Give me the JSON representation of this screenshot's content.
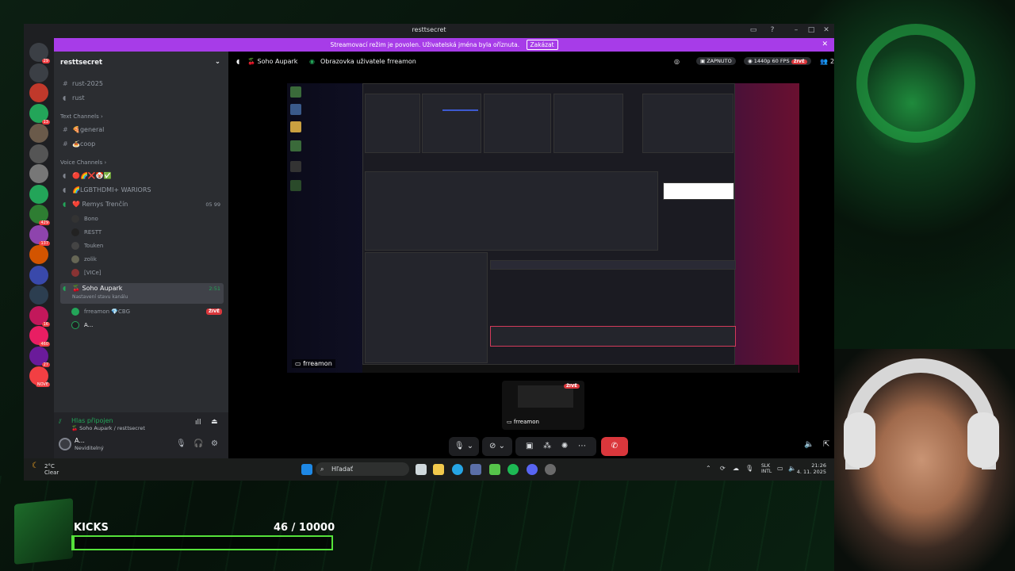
{
  "window": {
    "title": "resttsecret"
  },
  "banner": {
    "text": "Streamovací režim je povolen. Uživatelská jména byla oříznuta.",
    "button": "Zakázat"
  },
  "servers": [
    {
      "badge": "29"
    },
    {
      "badge": ""
    },
    {
      "badge": ""
    },
    {
      "badge": "13"
    },
    {
      "badge": ""
    },
    {
      "badge": ""
    },
    {
      "badge": ""
    },
    {
      "badge": ""
    },
    {
      "badge": "429"
    },
    {
      "badge": "137"
    },
    {
      "badge": ""
    },
    {
      "badge": ""
    },
    {
      "badge": ""
    },
    {
      "badge": "16"
    },
    {
      "badge": "460"
    },
    {
      "badge": "27"
    },
    {
      "badge": "NOVÉ"
    }
  ],
  "server_name": "resttsecret",
  "channels": {
    "top": [
      {
        "icon": "#",
        "name": "rust-2025"
      },
      {
        "icon": "🔊",
        "name": "rust"
      }
    ],
    "text_category": "Text Channels",
    "text": [
      {
        "icon": "#",
        "name": "🍕general"
      },
      {
        "icon": "#",
        "name": "🍝coop"
      }
    ],
    "voice_category": "Voice Channels",
    "voice": [
      {
        "name": "🔴🌈❌🤡✅",
        "count": ""
      },
      {
        "name": "🌈LGBTHDMI+ WARIORS",
        "count": ""
      },
      {
        "name": "❤️ Remys Trenčín",
        "count": "05 99"
      }
    ],
    "remys_members": [
      "Bono",
      "RESTT",
      "Touken",
      "zolik",
      "[VICe]"
    ],
    "active_channel": {
      "name": "🍒 Soho Aupark",
      "timer": "2:51",
      "status": "Nastavení stavu kanálu"
    },
    "active_members": [
      {
        "name": "frreamon 💎CBG",
        "live": "ŽIVĚ"
      },
      {
        "name": "A...",
        "live": ""
      }
    ]
  },
  "voice_panel": {
    "status": "Hlas připojen",
    "location": "🍒 Soho Aupark / resttsecret"
  },
  "user": {
    "name": "A...",
    "status": "Neviditelný"
  },
  "main_header": {
    "channel": "🍒 Soho Aupark",
    "screen": "Obrazovka uživatele frreamon",
    "recording": "ZAPNUTO",
    "quality": "1440p 60 FPS",
    "live": "ŽIVĚ",
    "viewers": "2"
  },
  "stream": {
    "label": "frreamon",
    "thumb_label": "frreamon",
    "thumb_live": "ŽIVĚ"
  },
  "taskbar": {
    "weather_temp": "2°C",
    "weather_desc": "Clear",
    "search": "Hľadať",
    "lang1": "SLK",
    "lang2": "INTL",
    "time": "21:26",
    "date": "4. 11. 2025"
  },
  "kicks": {
    "label": "KICKS",
    "current": 46,
    "goal_text": "46  / 10000",
    "fill_fraction": 0.0046
  },
  "colors": {
    "banner": "#a73ce8",
    "hangup": "#da373c",
    "live": "#da373c",
    "kicks_bar": "#55e23a"
  }
}
